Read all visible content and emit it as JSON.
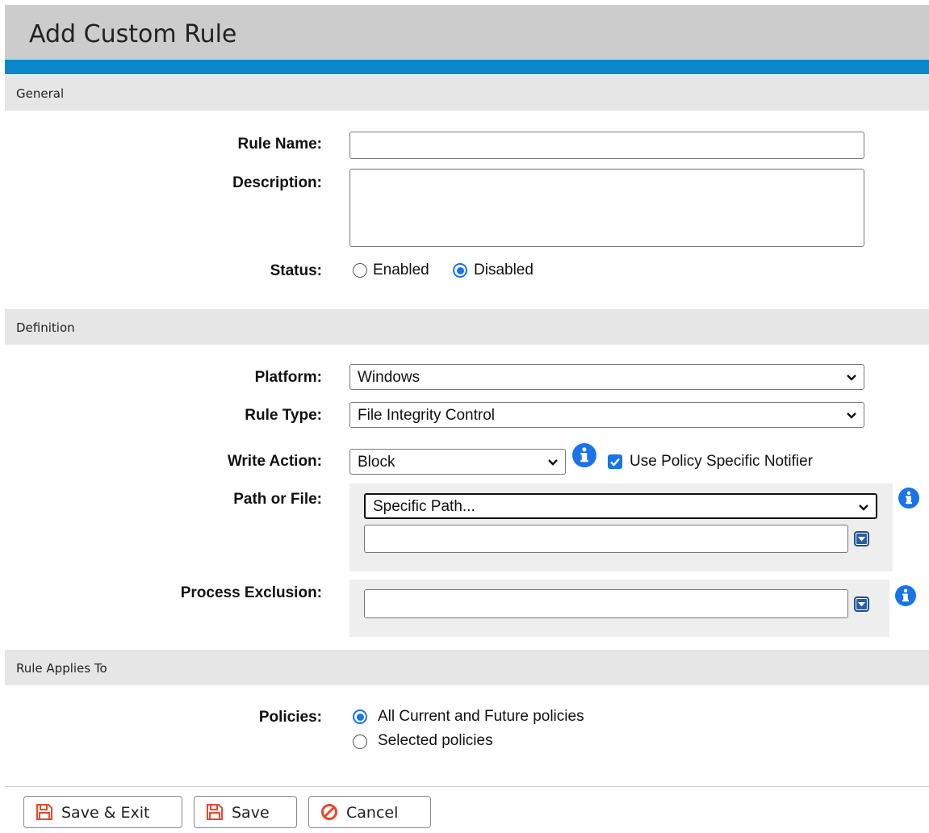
{
  "page": {
    "title": "Add Custom Rule"
  },
  "sections": {
    "general": "General",
    "definition": "Definition",
    "applies_to": "Rule Applies To"
  },
  "general": {
    "rule_name_label": "Rule Name:",
    "rule_name_value": "",
    "description_label": "Description:",
    "description_value": "",
    "status_label": "Status:",
    "status_options": [
      "Enabled",
      "Disabled"
    ],
    "status_selected": "Disabled"
  },
  "definition": {
    "platform_label": "Platform:",
    "platform_value": "Windows",
    "rule_type_label": "Rule Type:",
    "rule_type_value": "File Integrity Control",
    "write_action_label": "Write Action:",
    "write_action_value": "Block",
    "notifier_label": "Use Policy Specific Notifier",
    "notifier_checked": true,
    "path_label": "Path or File:",
    "path_select_value": "Specific Path...",
    "path_input_value": "",
    "process_exclusion_label": "Process Exclusion:",
    "process_exclusion_value": ""
  },
  "applies_to": {
    "policies_label": "Policies:",
    "options": [
      "All Current and Future policies",
      "Selected policies"
    ],
    "selected": "All Current and Future policies"
  },
  "footer": {
    "save_exit_label": "Save & Exit",
    "save_label": "Save",
    "cancel_label": "Cancel"
  },
  "colors": {
    "accent": "#0b87cc",
    "header_bg": "#cccccc",
    "section_bg": "#e6e6e6",
    "info_icon": "#1a73e8",
    "button_icon": "#e8482b"
  },
  "icons": {
    "info": "info-icon",
    "combo": "dropdown-arrow-icon",
    "save": "floppy-disk-icon",
    "cancel": "cancel-icon"
  }
}
